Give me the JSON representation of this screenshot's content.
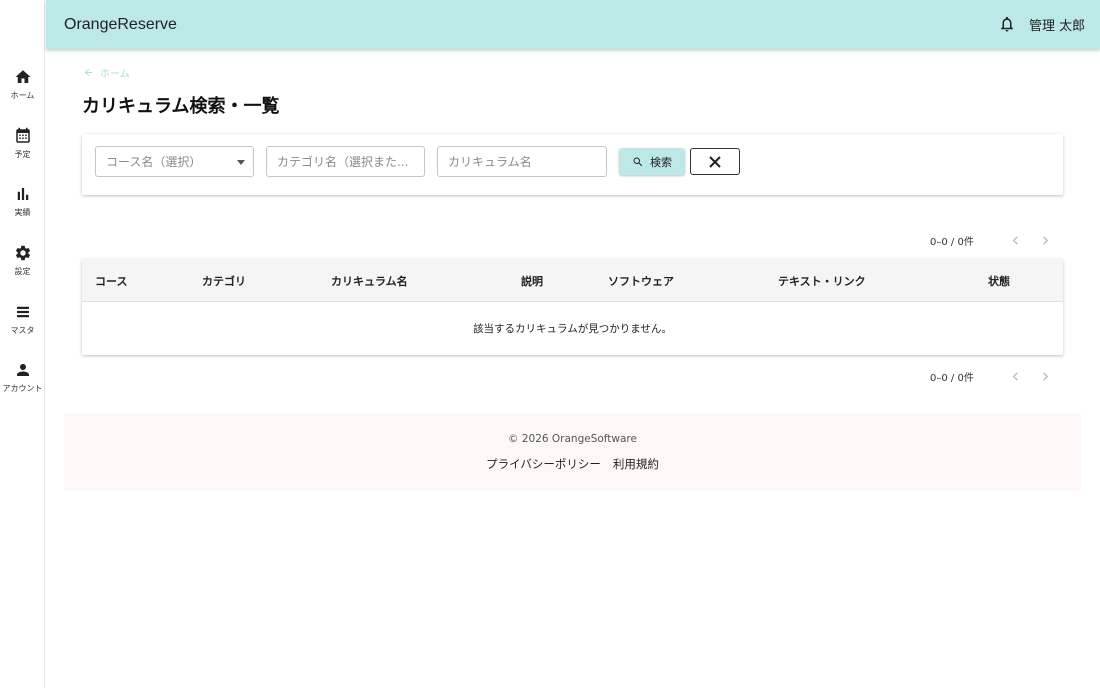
{
  "app": {
    "title": "OrangeReserve",
    "user_name": "管理 太郎"
  },
  "sidebar": {
    "items": [
      {
        "label": "ホーム",
        "icon": "home-icon"
      },
      {
        "label": "予定",
        "icon": "calendar-icon"
      },
      {
        "label": "実績",
        "icon": "bar-chart-icon"
      },
      {
        "label": "設定",
        "icon": "gear-icon"
      },
      {
        "label": "マスタ",
        "icon": "list-icon"
      },
      {
        "label": "アカウント",
        "icon": "person-icon"
      }
    ]
  },
  "breadcrumb": {
    "label": "ホーム",
    "icon": "arrow-left-icon"
  },
  "page": {
    "title": "カリキュラム検索・一覧"
  },
  "search": {
    "course_placeholder": "コース名（選択）",
    "category_placeholder": "カテゴリ名（選択また...",
    "curriculum_placeholder": "カリキュラム名",
    "search_label": "検索"
  },
  "pagination": {
    "range_text": "0–0 / 0件"
  },
  "table": {
    "columns": [
      "コース",
      "カテゴリ",
      "カリキュラム名",
      "説明",
      "ソフトウェア",
      "テキスト・リンク",
      "状態"
    ],
    "empty_message": "該当するカリキュラムが見つかりません。"
  },
  "footer": {
    "copyright": "© 2026 OrangeSoftware",
    "links": [
      "プライバシーポリシー",
      "利用規約"
    ]
  },
  "colors": {
    "appbar": "#bde8e8",
    "accent": "#a8dcdc",
    "footer_bg": "#fdf7f7"
  }
}
